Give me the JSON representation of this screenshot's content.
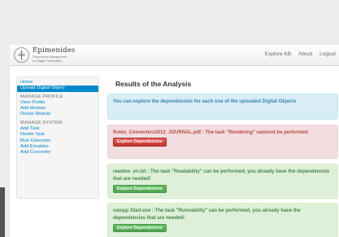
{
  "brand": {
    "name": "Epimenides",
    "subtitle_line1": "Dependency Management",
    "subtitle_line2": "for Digital Preservation"
  },
  "top_nav": {
    "explore_kb": "Explore KB",
    "about": "About",
    "logout": "Logout"
  },
  "sidebar": {
    "home": "Home",
    "upload": "Upload Digital Object",
    "manage_profile_header": "MANAGE PROFILE",
    "view_profile": "View Profile",
    "add_module": "Add Module",
    "delete_module": "Delete Module",
    "manage_system_header": "MANAGE SYSTEM",
    "add_task": "Add Task",
    "delete_task": "Delete Task",
    "risk_detection": "Risk Detection",
    "add_emulator": "Add Emulator",
    "add_converter": "Add Converter"
  },
  "main": {
    "title": "Results of the Analysis",
    "info_text": "You can explore the dependencies for each one of the uploaded Digital Objects",
    "results": [
      {
        "status": "error",
        "text": "Rules_Converters2012_JOURNAL.pdf : The task \"Rendering\" cannnot be performed",
        "button": "Explore Dependencies"
      },
      {
        "status": "success",
        "text": "readme_en.txt : The task \"Readability\" can be performed, you already have the dependencies that are needed!",
        "button": "Explore Dependencies"
      },
      {
        "status": "success",
        "text": "xampp Start.exe : The task \"Runnability\" can be performed, you already have the dependencies that are needed!",
        "button": "Explore Dependencies"
      }
    ]
  },
  "colors": {
    "link": "#0088cc",
    "info_text": "#3a87ad",
    "error_text": "#b94a48",
    "success_text": "#468847"
  },
  "icons": {
    "logo": "epimenides-logo-icon"
  }
}
